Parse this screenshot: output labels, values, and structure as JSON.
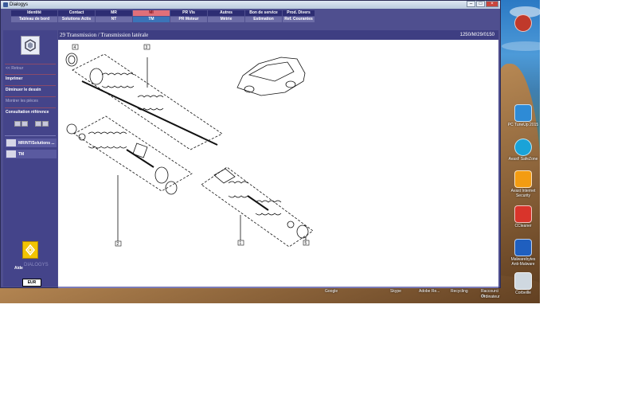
{
  "window": {
    "title": "Dialogys",
    "controls": {
      "minimize": "–",
      "maximize": "□",
      "close": "×"
    }
  },
  "menu": {
    "top": [
      "Identité",
      "Contact",
      "MR",
      "MI",
      "PR Vis",
      "Autres",
      "Bon de service",
      "Prod. Divers"
    ],
    "bottom": [
      "Tableau de bord",
      "Solutions Actis",
      "NT",
      "TM",
      "PR Moteur",
      "Métrie",
      "Estimation",
      "Ref. Courantes"
    ]
  },
  "sidebar": {
    "back": "<< Retour",
    "print": "Imprimer",
    "shrink": "Diminuer le dessin",
    "show_parts": "Montrer les pièces",
    "consult_ref": "Consultation référence",
    "doc_tabs": [
      "MR/NT/Solutions ...",
      "TM"
    ],
    "brand_text": "DIALOGYS",
    "help": "Aide",
    "currency": "EUR"
  },
  "content": {
    "title": "29 Transmission / Transmission latérale",
    "reference": "1250/M/29/0150",
    "callouts": [
      "4",
      "3",
      "2",
      "1",
      "5"
    ]
  },
  "desktop": {
    "icons": [
      "PC TuneUp 2015",
      "Avast! SafeZone",
      "Avast Internet Security",
      "CCleaner",
      "Malwarebytes Anti-Malware",
      "Corbeille"
    ],
    "taskbar_labels": [
      "Google",
      "Skype",
      "Adobe Re...",
      "Recycling",
      "Raccourci de ...",
      "Ordinateur"
    ]
  },
  "colors": {
    "window_bg": "#4f4f8f",
    "menu_top": "#2d2d73",
    "menu_bottom": "#6c6ca6",
    "active_tab": "#e0707a",
    "brand_yellow": "#f2c400"
  }
}
